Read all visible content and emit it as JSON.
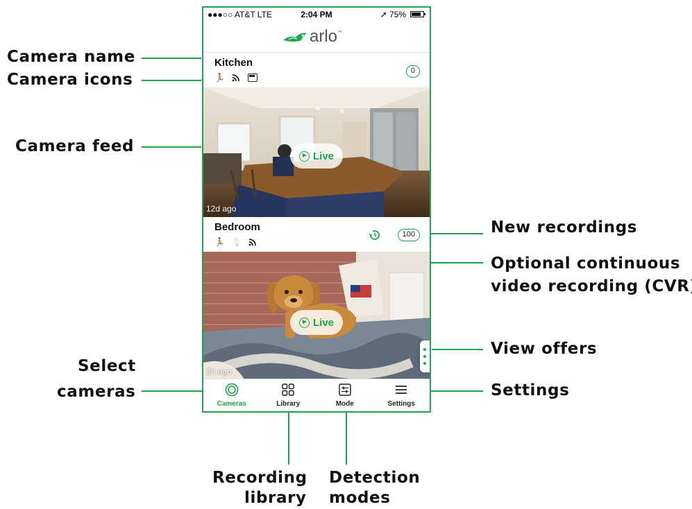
{
  "status_bar": {
    "carrier": "●●●○○ AT&T  LTE",
    "time": "2:04 PM",
    "battery": "➚ 75%"
  },
  "app": {
    "logo_text": "arlo",
    "logo_mark": "™"
  },
  "cameras": [
    {
      "name": "Kitchen",
      "new_recordings": "0",
      "live_label": "Live",
      "last_seen": "12d ago",
      "icons": [
        "motion-icon-dim",
        "wifi-icon",
        "battery-icon"
      ]
    },
    {
      "name": "Bedroom",
      "new_recordings": "100",
      "live_label": "Live",
      "last_seen": "2h ago",
      "icons": [
        "motion-icon",
        "audio-icon-dim",
        "wifi-icon"
      ],
      "cvr": true
    }
  ],
  "tabs": [
    {
      "label": "Cameras",
      "icon": "cameras-icon",
      "active": true
    },
    {
      "label": "Library",
      "icon": "library-grid-icon",
      "active": false
    },
    {
      "label": "Mode",
      "icon": "mode-sliders-icon",
      "active": false
    },
    {
      "label": "Settings",
      "icon": "menu-icon",
      "active": false
    }
  ],
  "callouts": {
    "camera_name": "Camera name",
    "camera_icons": "Camera icons",
    "camera_feed": "Camera feed",
    "select_cameras_1": "Select",
    "select_cameras_2": "cameras",
    "new_recordings": "New recordings",
    "cvr_1": "Optional continuous",
    "cvr_2": "video recording (CVR)",
    "view_offers": "View offers",
    "settings": "Settings",
    "recording_library_1": "Recording",
    "recording_library_2": "library",
    "detection_modes_1": "Detection",
    "detection_modes_2": "modes"
  },
  "colors": {
    "accent": "#1aa64a"
  }
}
